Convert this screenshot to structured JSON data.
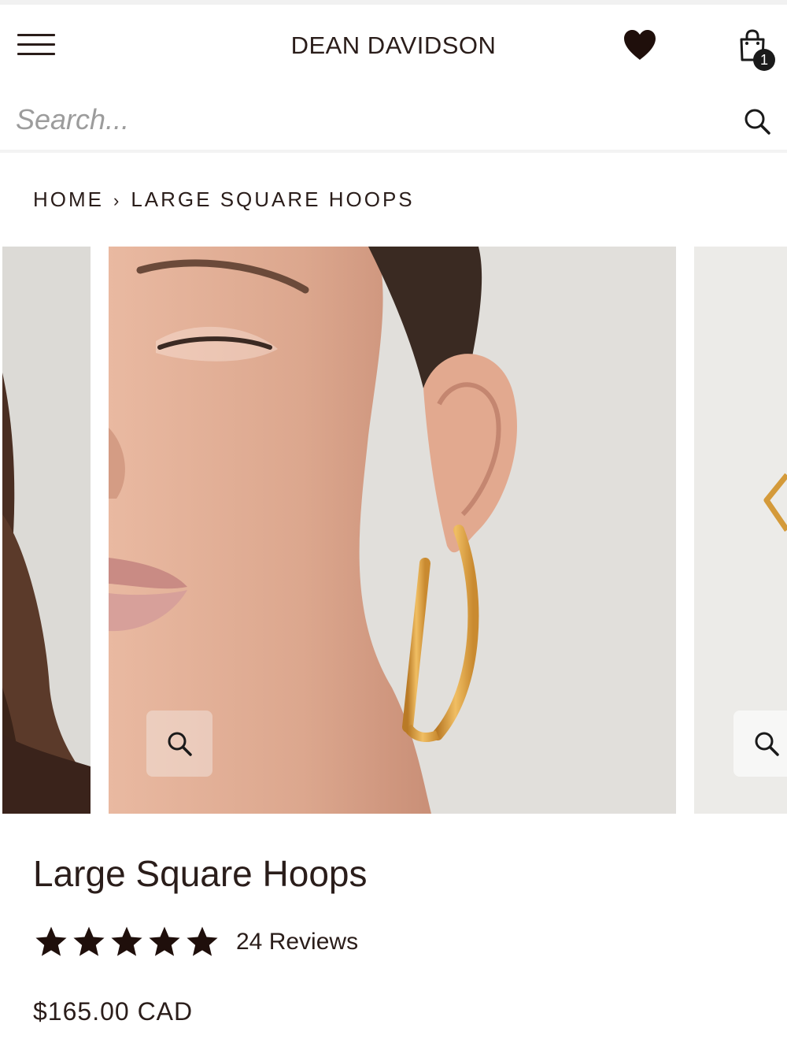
{
  "header": {
    "brand": "DEAN DAVIDSON",
    "cart_count": "1",
    "icons": {
      "menu": "hamburger-icon",
      "wishlist": "heart-icon",
      "cart": "shopping-bag-icon"
    }
  },
  "search": {
    "placeholder": "Search...",
    "value": "",
    "icon": "search-icon"
  },
  "breadcrumb": {
    "home": "HOME",
    "separator": "›",
    "current": "LARGE SQUARE HOOPS"
  },
  "gallery": {
    "slides": [
      "model-side-view",
      "model-ear-hoop-closeup",
      "hoop-product-shot"
    ],
    "zoom_icon": "magnifier-icon"
  },
  "product": {
    "title": "Large Square Hoops",
    "rating": 5,
    "rating_max": 5,
    "reviews": "24 Reviews",
    "price": "$165.00 CAD"
  },
  "colors": {
    "text": "#2a1d1a",
    "accent_gold": "#d49a3a",
    "badge": "#1a1a1a"
  }
}
